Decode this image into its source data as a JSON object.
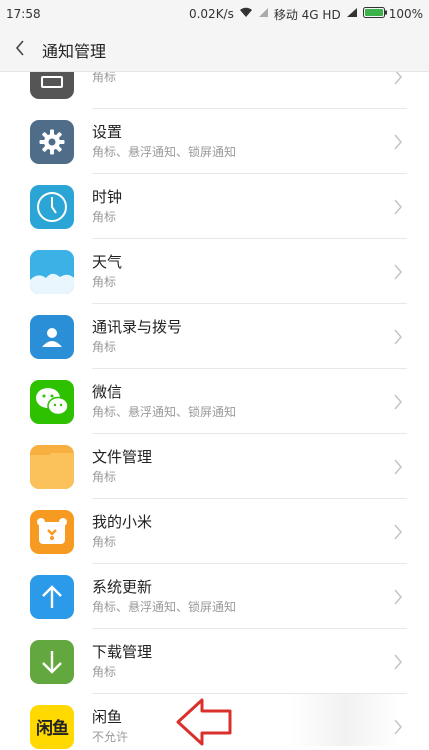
{
  "status_bar": {
    "time": "17:58",
    "speed": "0.02K/s",
    "carrier": "移动 4G HD",
    "battery": "100%",
    "battery_color": "#3bb34a"
  },
  "header": {
    "title": "通知管理",
    "back_icon": "chevron-left-icon"
  },
  "apps": [
    {
      "name": "",
      "sub": "角标",
      "icon": "partial-app-icon",
      "color": "#555555"
    },
    {
      "name": "设置",
      "sub": "角标、悬浮通知、锁屏通知",
      "icon": "gear-icon",
      "color": "#4f6d89"
    },
    {
      "name": "时钟",
      "sub": "角标",
      "icon": "clock-icon",
      "color": "#2aa5d6"
    },
    {
      "name": "天气",
      "sub": "角标",
      "icon": "weather-icon",
      "color": "#3bb1e6"
    },
    {
      "name": "通讯录与拨号",
      "sub": "角标",
      "icon": "contacts-icon",
      "color": "#2a8fd6"
    },
    {
      "name": "微信",
      "sub": "角标、悬浮通知、锁屏通知",
      "icon": "wechat-icon",
      "color": "#2dc100"
    },
    {
      "name": "文件管理",
      "sub": "角标",
      "icon": "folder-icon",
      "color": "#f7b040"
    },
    {
      "name": "我的小米",
      "sub": "角标",
      "icon": "mi-bear-icon",
      "color": "#f79a22"
    },
    {
      "name": "系统更新",
      "sub": "角标、悬浮通知、锁屏通知",
      "icon": "arrow-up-icon",
      "color": "#2b9ae8"
    },
    {
      "name": "下载管理",
      "sub": "角标",
      "icon": "arrow-down-icon",
      "color": "#63a83e"
    },
    {
      "name": "闲鱼",
      "sub": "不允许",
      "icon": "xianyu-icon",
      "color": "#ffd900",
      "icon_text": "闲鱼"
    }
  ],
  "annotation": {
    "color": "#d9302c"
  }
}
